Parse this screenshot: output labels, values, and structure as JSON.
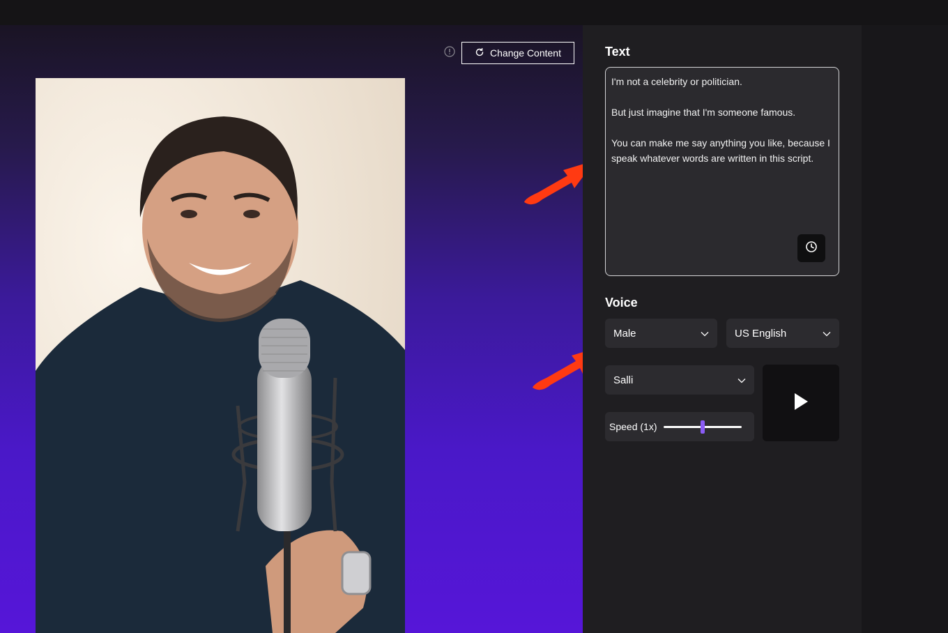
{
  "canvas": {
    "change_content_label": "Change Content"
  },
  "panel": {
    "text_section": {
      "title": "Text",
      "script": "I'm not a celebrity or politician.\n\nBut just imagine that I'm someone famous.\n\nYou can make me say anything you like, because I speak whatever words are written in this script."
    },
    "voice_section": {
      "title": "Voice",
      "gender_selected": "Male",
      "language_selected": "US English",
      "voice_selected": "Salli",
      "speed_label": "Speed (1x)",
      "speed_fraction": 0.5
    }
  },
  "colors": {
    "accent": "#8b5cf6",
    "annotation_arrow": "#ff3a12",
    "gradient_bottom": "#5616d8"
  },
  "icons": [
    "info-icon",
    "refresh-icon",
    "history-icon",
    "chevron-down-icon",
    "play-icon"
  ]
}
